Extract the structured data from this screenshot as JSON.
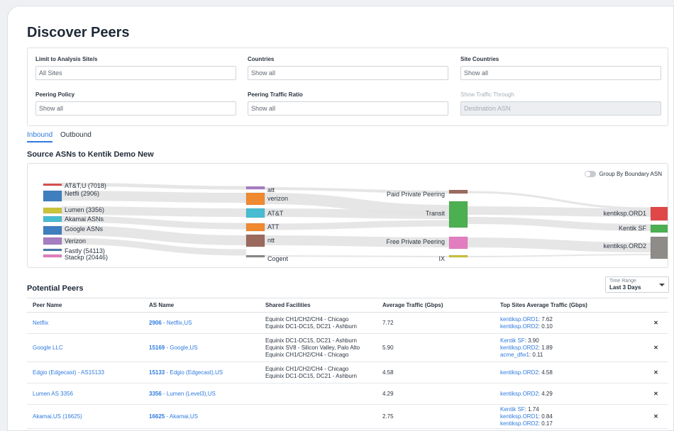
{
  "page_title": "Discover Peers",
  "filters": [
    {
      "label": "Limit to Analysis Site/s",
      "value": "All Sites",
      "disabled": false
    },
    {
      "label": "Countries",
      "value": "Show all",
      "disabled": false
    },
    {
      "label": "Site Countries",
      "value": "Show all",
      "disabled": false
    },
    {
      "label": "Peering Policy",
      "value": "Show all",
      "disabled": false
    },
    {
      "label": "Peering Traffic Ratio",
      "value": "Show all",
      "disabled": false
    },
    {
      "label": "Show Traffic Through",
      "value": "Destination ASN",
      "disabled": true
    }
  ],
  "tabs": [
    {
      "label": "Inbound",
      "active": true
    },
    {
      "label": "Outbound",
      "active": false
    }
  ],
  "sankey": {
    "title": "Source ASNs to Kentik Demo New",
    "toggle_label": "Group By Boundary ASN",
    "sources": [
      {
        "label": "AT&T,U (7018)",
        "color": "#d9534f"
      },
      {
        "label": "Netfli (2906)",
        "color": "#3f7fbf"
      },
      {
        "label": "Lumen (3356)",
        "color": "#c9c43a"
      },
      {
        "label": "Akamai ASNs",
        "color": "#48bcd0"
      },
      {
        "label": "Google ASNs",
        "color": "#3f7fbf"
      },
      {
        "label": "Verizon",
        "color": "#a77dc2"
      },
      {
        "label": "Fastly (54113)",
        "color": "#4a7ab0"
      },
      {
        "label": "Stackp (20446)",
        "color": "#e27ec0"
      }
    ],
    "handoffs": [
      {
        "label": "att",
        "color": "#a77dc2"
      },
      {
        "label": "verizon",
        "color": "#f08a30"
      },
      {
        "label": "AT&T",
        "color": "#48bcd0"
      },
      {
        "label": "ATT",
        "color": "#f08a30"
      },
      {
        "label": "ntt",
        "color": "#9b6a5e"
      },
      {
        "label": "Cogent",
        "color": "#8a8a8a"
      }
    ],
    "connection_types": [
      {
        "label": "Paid Private Peering",
        "color": "#9b6a5e"
      },
      {
        "label": "Transit",
        "color": "#4caf50"
      },
      {
        "label": "Free Private Peering",
        "color": "#e27ec0"
      },
      {
        "label": "IX",
        "color": "#c9c43a"
      }
    ],
    "sites": [
      {
        "label": "kentiksp.ORD1",
        "color": "#e04848"
      },
      {
        "label": "Kentik SF",
        "color": "#4caf50"
      },
      {
        "label": "kentiksp.ORD2",
        "color": "#8f8b88"
      }
    ],
    "link_color": "#e3e3e3"
  },
  "potential_peers": {
    "title": "Potential Peers",
    "time_range": {
      "label": "Time Range",
      "value": "Last 3 Days"
    },
    "columns": [
      "Peer Name",
      "AS Name",
      "Shared Facilities",
      "Average Traffic (Gbps)",
      "Top Sites Average Traffic (Gbps)"
    ],
    "rows": [
      {
        "peer_name": "Netflix",
        "asn": "2906",
        "as_name": " - Netflix,US",
        "facilities": [
          "Equinix CH1/CH2/CH4 - Chicago",
          "Equinix DC1-DC15, DC21 - Ashburn"
        ],
        "avg_traffic": "7.72",
        "top_sites": [
          {
            "site": "kentiksp.ORD1",
            "value": ": 7.62"
          },
          {
            "site": "kentiksp.ORD2",
            "value": ": 0.10"
          }
        ]
      },
      {
        "peer_name": "Google LLC",
        "asn": "15169",
        "as_name": " - Google,US",
        "facilities": [
          "Equinix DC1-DC15, DC21 - Ashburn",
          "Equinix SV8 - Silicon Valley, Palo Alto",
          "Equinix CH1/CH2/CH4 - Chicago"
        ],
        "avg_traffic": "5.90",
        "top_sites": [
          {
            "site": "Kentik SF",
            "value": ": 3.90"
          },
          {
            "site": "kentiksp.ORD2",
            "value": ": 1.89"
          },
          {
            "site": "acme_dfw1",
            "value": ": 0.11"
          }
        ]
      },
      {
        "peer_name": "Edgio (Edgecast) - AS15133",
        "asn": "15133",
        "as_name": " - Edgio (Edgecast),US",
        "facilities": [
          "Equinix CH1/CH2/CH4 - Chicago",
          "Equinix DC1-DC15, DC21 - Ashburn"
        ],
        "avg_traffic": "4.58",
        "top_sites": [
          {
            "site": "kentiksp.ORD2",
            "value": ": 4.58"
          }
        ]
      },
      {
        "peer_name": "Lumen AS 3356",
        "asn": "3356",
        "as_name": " - Lumen (Level3),US",
        "facilities": [],
        "avg_traffic": "4.29",
        "top_sites": [
          {
            "site": "kentiksp.ORD2",
            "value": ": 4.29"
          }
        ]
      },
      {
        "peer_name": "Akamai,US (16625)",
        "asn": "16625",
        "as_name": " - Akamai,US",
        "facilities": [],
        "avg_traffic": "2.75",
        "top_sites": [
          {
            "site": "Kentik SF",
            "value": ": 1.74"
          },
          {
            "site": "kentiksp.ORD1",
            "value": ": 0.84"
          },
          {
            "site": "kentiksp.ORD2",
            "value": ": 0.17"
          }
        ]
      }
    ]
  }
}
